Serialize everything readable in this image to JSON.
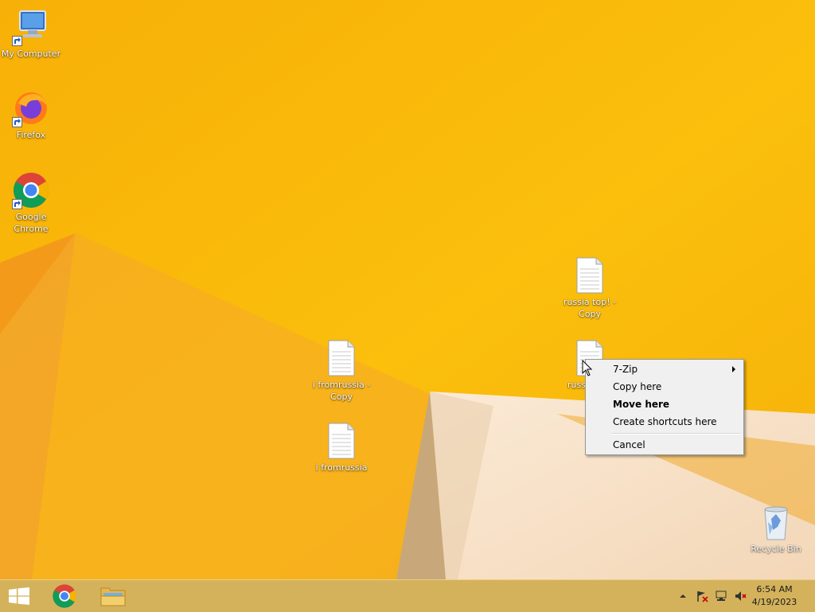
{
  "desktop": {
    "icons": [
      {
        "id": "my-computer",
        "label": "My Computer",
        "icon": "computer-icon",
        "shortcut": true
      },
      {
        "id": "firefox",
        "label": "Firefox",
        "icon": "firefox-icon",
        "shortcut": true
      },
      {
        "id": "chrome",
        "label": "Google Chrome",
        "icon": "chrome-icon",
        "shortcut": true
      },
      {
        "id": "russia-top-copy",
        "label": "russia top! - Copy",
        "icon": "text-file-icon",
        "shortcut": false
      },
      {
        "id": "russia-top",
        "label": "russ",
        "icon": "text-file-icon",
        "shortcut": false
      },
      {
        "id": "ifromrussia-copy",
        "label": "i fromrussia - Copy",
        "icon": "text-file-icon",
        "shortcut": false
      },
      {
        "id": "ifromrussia",
        "label": "i fromrussia",
        "icon": "text-file-icon",
        "shortcut": false
      },
      {
        "id": "recycle-bin",
        "label": "Recycle Bin",
        "icon": "recycle-bin-icon",
        "shortcut": false
      }
    ]
  },
  "context_menu": {
    "items": [
      {
        "label": "7-Zip",
        "submenu": true,
        "bold": false
      },
      {
        "label": "Copy here",
        "submenu": false,
        "bold": false
      },
      {
        "label": "Move here",
        "submenu": false,
        "bold": true
      },
      {
        "label": "Create shortcuts here",
        "submenu": false,
        "bold": false
      },
      {
        "label": "Cancel",
        "submenu": false,
        "bold": false
      }
    ]
  },
  "taskbar": {
    "start_icon": "windows-logo-icon",
    "pinned": [
      {
        "name": "chrome",
        "icon": "chrome-icon"
      },
      {
        "name": "file-explorer",
        "icon": "folder-icon"
      }
    ],
    "tray_icons": [
      "show-hidden-icons-arrow",
      "action-center-flag-icon",
      "network-icon",
      "volume-muted-icon"
    ],
    "clock": {
      "time": "6:54 AM",
      "date": "4/19/2023"
    }
  },
  "colors": {
    "wallpaper": "#f9b706",
    "taskbar": "#d4b25c",
    "menu_bg": "#f0f0f0"
  }
}
